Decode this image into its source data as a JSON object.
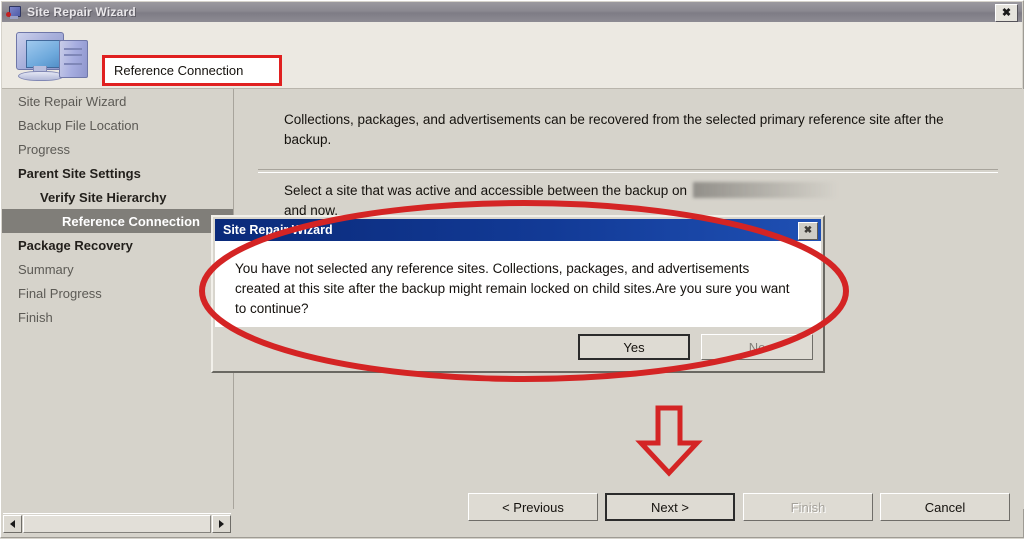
{
  "window": {
    "title": "Site Repair Wizard",
    "icon": "wizard-icon",
    "close_label": "✖"
  },
  "header": {
    "page_title": "Reference Connection",
    "icon": "computer-icon",
    "highlight_color": "#e02020"
  },
  "sidebar": {
    "items": [
      {
        "label": "Site Repair Wizard",
        "level": 0,
        "bold": false,
        "selected": false
      },
      {
        "label": "Backup File Location",
        "level": 0,
        "bold": false,
        "selected": false
      },
      {
        "label": "Progress",
        "level": 0,
        "bold": false,
        "selected": false
      },
      {
        "label": "Parent Site Settings",
        "level": 0,
        "bold": true,
        "selected": false
      },
      {
        "label": "Verify Site Hierarchy",
        "level": 1,
        "bold": true,
        "selected": false
      },
      {
        "label": "Reference Connection",
        "level": 2,
        "bold": true,
        "selected": true
      },
      {
        "label": "Package Recovery",
        "level": 0,
        "bold": true,
        "selected": false
      },
      {
        "label": "Summary",
        "level": 0,
        "bold": false,
        "selected": false
      },
      {
        "label": "Final Progress",
        "level": 0,
        "bold": false,
        "selected": false
      },
      {
        "label": "Finish",
        "level": 0,
        "bold": false,
        "selected": false
      }
    ],
    "scrollbar": {
      "left_arrow": "◀",
      "right_arrow": "▶"
    }
  },
  "main": {
    "intro_text": "Collections, packages, and advertisements can be recovered from the selected primary reference site after the backup.",
    "select_text_before": "Select a site that was active and accessible between the backup on",
    "select_text_after": "and now.",
    "blurred_date": ""
  },
  "buttons": {
    "previous": "< Previous",
    "next": "Next >",
    "finish": "Finish",
    "cancel": "Cancel"
  },
  "dialog": {
    "title": "Site Repair Wizard",
    "close_label": "✖",
    "message": "You have not selected any reference sites. Collections, packages, and advertisements created at this site after the backup might remain locked on child sites.Are you sure you want to continue?",
    "yes": "Yes",
    "no": "No"
  },
  "annotations": {
    "ellipse_color": "#d42424",
    "arrow_color": "#d42424",
    "box_color": "#e02020"
  }
}
